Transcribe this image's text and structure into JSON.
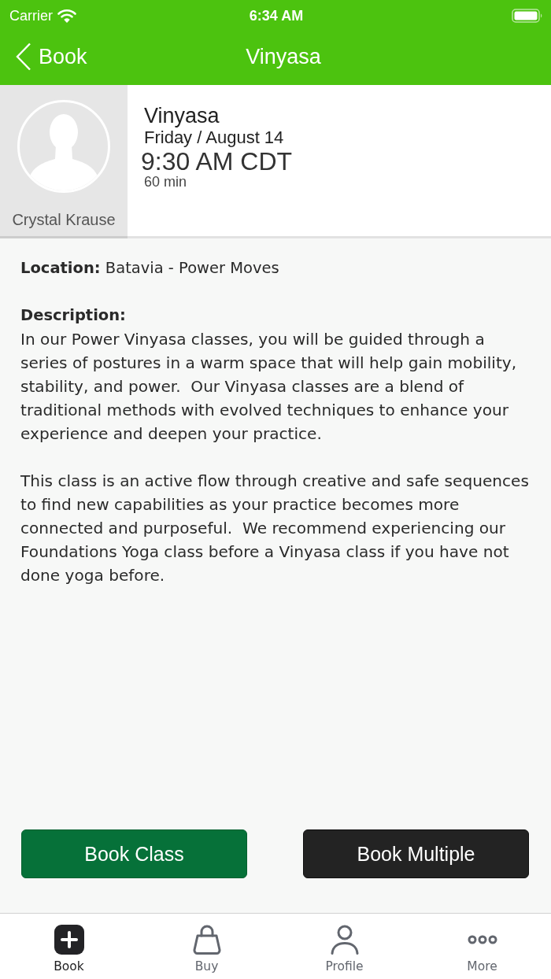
{
  "status_bar": {
    "carrier": "Carrier",
    "time": "6:34 AM"
  },
  "nav_bar": {
    "back_label": "Book",
    "title": "Vinyasa"
  },
  "class_header": {
    "instructor": "Crystal Krause",
    "class_name": "Vinyasa",
    "date": "Friday / August 14",
    "time": "9:30 AM CDT",
    "duration": "60 min"
  },
  "details": {
    "location": "**Location:** Batavia - Power Moves",
    "description_label": "Description:",
    "paragraphs": [
      "In our Power Vinyasa classes, you will be guided through a series of postures in a warm space that will help gain mobility, stability, and power.  Our Vinyasa classes are a blend of traditional methods with evolved techniques to enhance your experience and deepen your practice.",
      "This class is an active flow through creative and safe sequences to find new capabilities as your practice becomes more connected and purposeful.  We recommend experiencing our Foundations Yoga class before a Vinyasa class if you have not done yoga before."
    ]
  },
  "actions": [
    {
      "label": "Book Class",
      "kind": "primary"
    },
    {
      "label": "Book Multiple",
      "kind": "secondary"
    }
  ],
  "tab_bar": {
    "tabs": [
      {
        "label": "Book",
        "selected": true
      },
      {
        "label": "Buy",
        "selected": false
      },
      {
        "label": "Profile",
        "selected": false
      },
      {
        "label": "More",
        "selected": false
      }
    ]
  }
}
